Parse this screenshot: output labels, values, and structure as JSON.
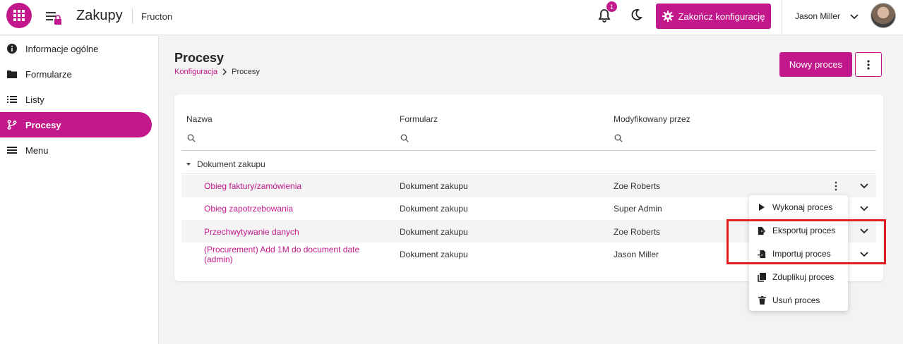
{
  "header": {
    "app_title": "Zakupy",
    "company": "Fructon",
    "notification_count": "1",
    "finish_config_label": "Zakończ konfigurację",
    "user_name": "Jason Miller"
  },
  "sidebar": {
    "items": [
      {
        "label": "Informacje ogólne",
        "icon": "info-icon"
      },
      {
        "label": "Formularze",
        "icon": "folder-icon"
      },
      {
        "label": "Listy",
        "icon": "list-icon"
      },
      {
        "label": "Procesy",
        "icon": "process-branch-icon",
        "active": true
      },
      {
        "label": "Menu",
        "icon": "menu-icon"
      }
    ]
  },
  "page": {
    "title": "Procesy",
    "breadcrumb_parent": "Konfiguracja",
    "breadcrumb_current": "Procesy",
    "new_process_label": "Nowy proces"
  },
  "table": {
    "columns": [
      "Nazwa",
      "Formularz",
      "Modyfikowany przez"
    ],
    "group_label": "Dokument zakupu",
    "rows": [
      {
        "name": "Obieg faktury/zamówienia",
        "form": "Dokument zakupu",
        "modified_by": "Zoe Roberts"
      },
      {
        "name": "Obieg zapotrzebowania",
        "form": "Dokument zakupu",
        "modified_by": "Super Admin"
      },
      {
        "name": "Przechwytywanie danych",
        "form": "Dokument zakupu",
        "modified_by": "Zoe Roberts"
      },
      {
        "name": "(Procurement) Add 1M do document date (admin)",
        "form": "Dokument zakupu",
        "modified_by": "Jason Miller"
      }
    ]
  },
  "context_menu": {
    "items": [
      {
        "label": "Wykonaj proces",
        "icon": "play-icon"
      },
      {
        "label": "Eksportuj proces",
        "icon": "export-file-icon"
      },
      {
        "label": "Importuj proces",
        "icon": "import-file-icon"
      },
      {
        "label": "Zduplikuj proces",
        "icon": "duplicate-icon"
      },
      {
        "label": "Usuń proces",
        "icon": "trash-icon"
      }
    ]
  },
  "colors": {
    "accent": "#c2188b",
    "highlight": "#e02020"
  }
}
